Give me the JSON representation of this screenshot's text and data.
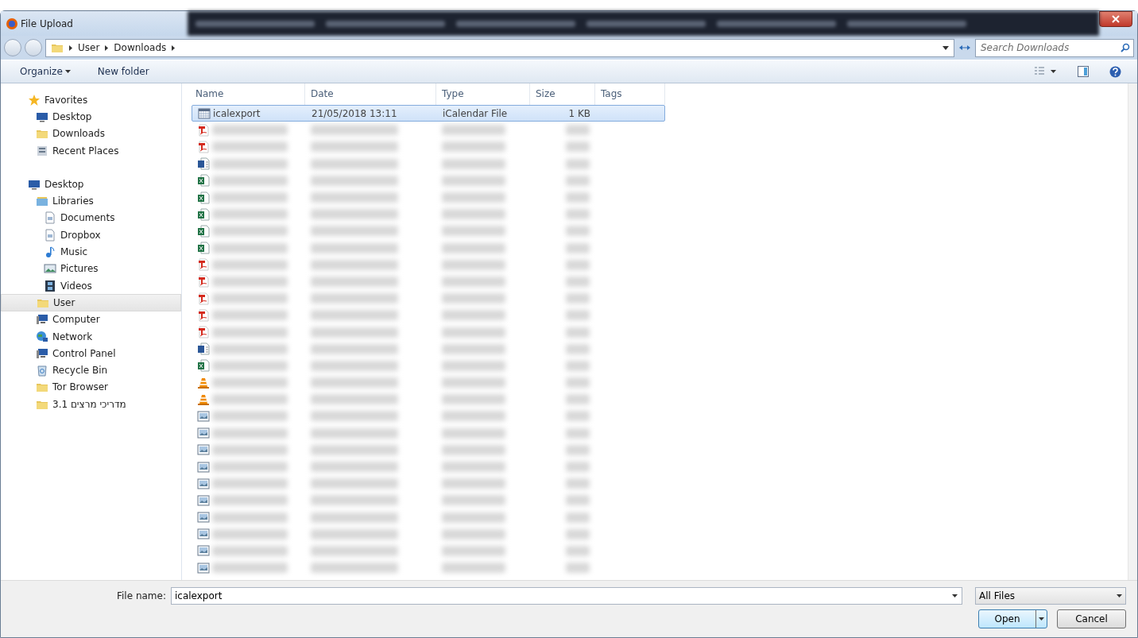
{
  "window": {
    "title": "File Upload"
  },
  "address": {
    "path": [
      "User",
      "Downloads"
    ],
    "search": {
      "placeholder": "Search Downloads"
    }
  },
  "toolbar": {
    "items": [
      {
        "label": "Organize",
        "dropdown": true
      },
      {
        "label": "New folder",
        "dropdown": false
      }
    ]
  },
  "sidebar": {
    "items": [
      {
        "label": "Favorites",
        "kind": "star",
        "selected": false,
        "children": [
          {
            "label": "Desktop",
            "kind": "desktop",
            "selected": false
          },
          {
            "label": "Downloads",
            "kind": "folder",
            "selected": false
          },
          {
            "label": "Recent Places",
            "kind": "recent",
            "selected": false
          }
        ]
      },
      {
        "label": "Desktop",
        "kind": "desktop",
        "selected": false,
        "children": [
          {
            "label": "Libraries",
            "kind": "library",
            "selected": false,
            "children": [
              {
                "label": "Documents",
                "kind": "document",
                "selected": false
              },
              {
                "label": "Dropbox",
                "kind": "document",
                "selected": false
              },
              {
                "label": "Music",
                "kind": "music",
                "selected": false
              },
              {
                "label": "Pictures",
                "kind": "picture",
                "selected": false
              },
              {
                "label": "Videos",
                "kind": "video",
                "selected": false
              }
            ]
          },
          {
            "label": "User",
            "kind": "folder",
            "selected": true
          },
          {
            "label": "Computer",
            "kind": "computer",
            "selected": false
          },
          {
            "label": "Network",
            "kind": "network",
            "selected": false
          },
          {
            "label": "Control Panel",
            "kind": "computer",
            "selected": false
          },
          {
            "label": "Recycle Bin",
            "kind": "recycle",
            "selected": false
          },
          {
            "label": "Tor Browser",
            "kind": "folder",
            "selected": false
          },
          {
            "label": "מדריכי מרצים 3.1",
            "kind": "folder",
            "selected": false
          }
        ]
      }
    ]
  },
  "table": {
    "columns": [
      "Name",
      "Date",
      "Type",
      "Size",
      "Tags"
    ],
    "rows": [
      {
        "kind": "calendar",
        "selected": true,
        "name": "icalexport",
        "date": "21/05/2018 13:11",
        "type": "iCalendar File",
        "size": "1 KB"
      },
      {
        "kind": "pdf",
        "selected": false
      },
      {
        "kind": "pdf",
        "selected": false
      },
      {
        "kind": "word",
        "selected": false
      },
      {
        "kind": "excel",
        "selected": false
      },
      {
        "kind": "excel",
        "selected": false
      },
      {
        "kind": "excel",
        "selected": false
      },
      {
        "kind": "excel",
        "selected": false
      },
      {
        "kind": "excel",
        "selected": false
      },
      {
        "kind": "pdf",
        "selected": false
      },
      {
        "kind": "pdf",
        "selected": false
      },
      {
        "kind": "pdf",
        "selected": false
      },
      {
        "kind": "pdf",
        "selected": false
      },
      {
        "kind": "pdf",
        "selected": false
      },
      {
        "kind": "word",
        "selected": false
      },
      {
        "kind": "excel",
        "selected": false
      },
      {
        "kind": "vlc",
        "selected": false
      },
      {
        "kind": "vlc",
        "selected": false
      },
      {
        "kind": "image",
        "selected": false
      },
      {
        "kind": "image",
        "selected": false
      },
      {
        "kind": "image",
        "selected": false
      },
      {
        "kind": "image",
        "selected": false
      },
      {
        "kind": "image",
        "selected": false
      },
      {
        "kind": "image",
        "selected": false
      },
      {
        "kind": "image",
        "selected": false
      },
      {
        "kind": "image",
        "selected": false
      },
      {
        "kind": "image",
        "selected": false
      },
      {
        "kind": "image",
        "selected": false
      }
    ]
  },
  "footer": {
    "file_name_label": "File name:",
    "file_name": "icalexport",
    "filter": "All Files",
    "buttons": [
      {
        "label": "Open",
        "kind": "split"
      },
      {
        "label": "Cancel",
        "kind": "plain"
      }
    ]
  }
}
